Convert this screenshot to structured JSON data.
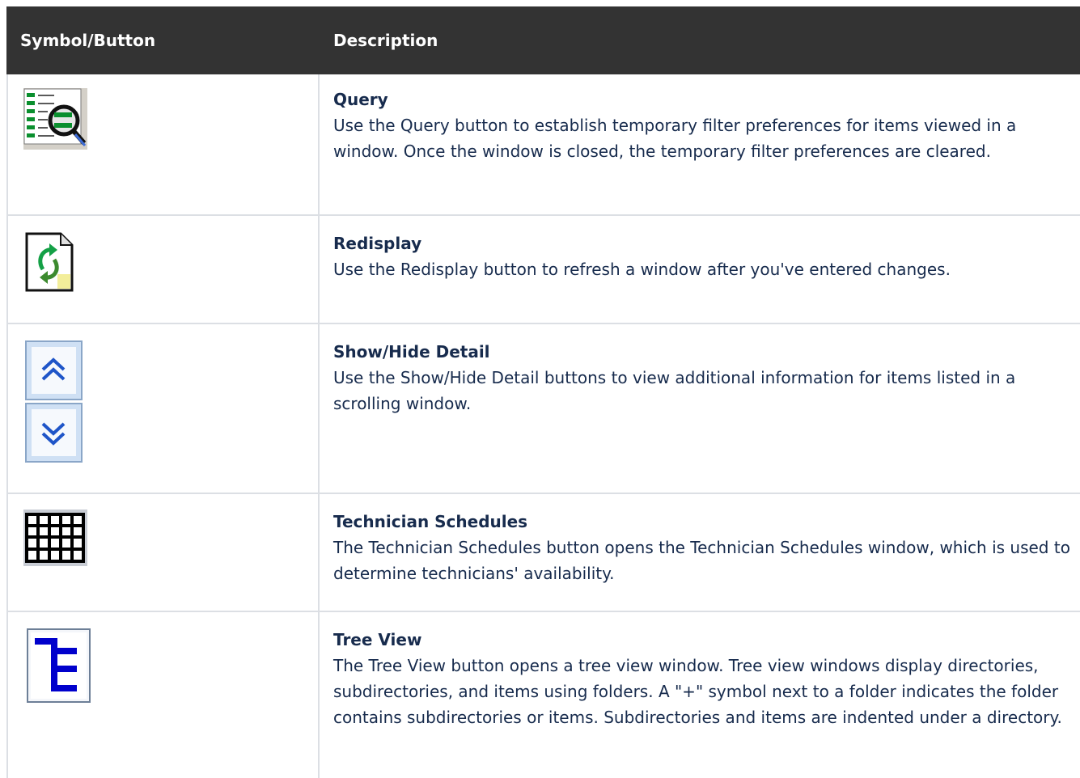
{
  "headers": {
    "symbol": "Symbol/Button",
    "description": "Description"
  },
  "rows": [
    {
      "icon": "query-icon",
      "title": "Query",
      "text": "Use the Query button to establish temporary filter preferences for items viewed in a window. Once the window is closed, the temporary filter preferences are cleared."
    },
    {
      "icon": "redisplay-icon",
      "title": "Redisplay",
      "text": "Use the Redisplay button to refresh a window after you've entered changes."
    },
    {
      "icon": "show-hide-detail-icon",
      "title": "Show/Hide Detail",
      "text": "Use the Show/Hide Detail buttons to view additional information for items listed in a scrolling window."
    },
    {
      "icon": "technician-schedules-icon",
      "title": "Technician Schedules",
      "text": "The Technician Schedules button opens the Technician Schedules window, which is used to determine technicians' availability."
    },
    {
      "icon": "tree-view-icon",
      "title": "Tree View",
      "text": "The Tree View button opens a tree view window. Tree view windows display directories, subdirectories, and items using folders. A \"+\" symbol next to a folder indicates the folder contains subdirectories or items. Subdirectories and items are indented under a directory."
    }
  ]
}
